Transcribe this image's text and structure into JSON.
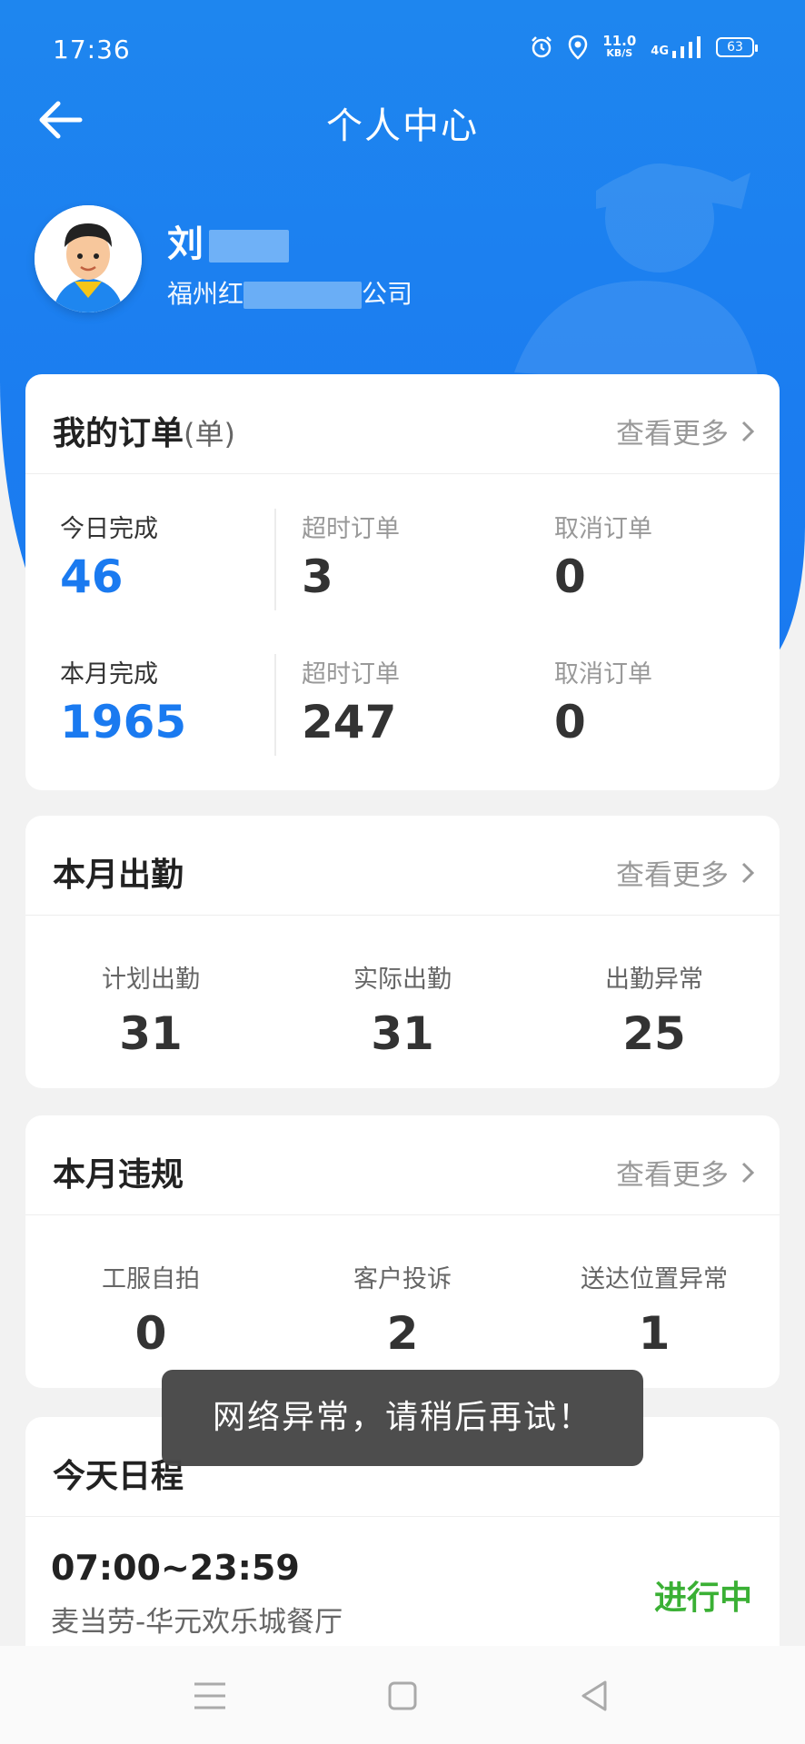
{
  "status_bar": {
    "time": "17:36",
    "net_speed_value": "11.0",
    "net_speed_unit": "KB/S",
    "network": "4G",
    "battery": "63"
  },
  "header": {
    "title": "个人中心",
    "back_icon": "arrow-left-icon"
  },
  "profile": {
    "name": "刘",
    "company_prefix": "福州红",
    "company_suffix": "公司"
  },
  "orders": {
    "title": "我的订单",
    "unit": "(单)",
    "more": "查看更多",
    "rows": [
      {
        "main_label": "今日完成",
        "main_value": "46",
        "overtime_label": "超时订单",
        "overtime_value": "3",
        "cancel_label": "取消订单",
        "cancel_value": "0"
      },
      {
        "main_label": "本月完成",
        "main_value": "1965",
        "overtime_label": "超时订单",
        "overtime_value": "247",
        "cancel_label": "取消订单",
        "cancel_value": "0"
      }
    ]
  },
  "attendance": {
    "title": "本月出勤",
    "more": "查看更多",
    "stats": [
      {
        "label": "计划出勤",
        "value": "31"
      },
      {
        "label": "实际出勤",
        "value": "31"
      },
      {
        "label": "出勤异常",
        "value": "25"
      }
    ]
  },
  "violations": {
    "title": "本月违规",
    "more": "查看更多",
    "stats": [
      {
        "label": "工服自拍",
        "value": "0"
      },
      {
        "label": "客户投诉",
        "value": "2"
      },
      {
        "label": "送达位置异常",
        "value": "1"
      }
    ]
  },
  "schedule": {
    "title": "今天日程",
    "time": "07:00~23:59",
    "place": "麦当劳-华元欢乐城餐厅",
    "status": "进行中"
  },
  "toast": "网络异常，请稍后再试！",
  "colors": {
    "primary": "#1a7af0",
    "success": "#3ab034"
  }
}
